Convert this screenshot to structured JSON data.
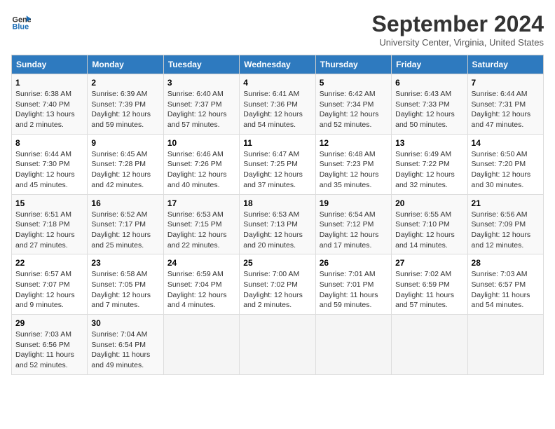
{
  "header": {
    "logo_line1": "General",
    "logo_line2": "Blue",
    "month": "September 2024",
    "location": "University Center, Virginia, United States"
  },
  "columns": [
    "Sunday",
    "Monday",
    "Tuesday",
    "Wednesday",
    "Thursday",
    "Friday",
    "Saturday"
  ],
  "weeks": [
    [
      {
        "day": "1",
        "info": "Sunrise: 6:38 AM\nSunset: 7:40 PM\nDaylight: 13 hours\nand 2 minutes."
      },
      {
        "day": "2",
        "info": "Sunrise: 6:39 AM\nSunset: 7:39 PM\nDaylight: 12 hours\nand 59 minutes."
      },
      {
        "day": "3",
        "info": "Sunrise: 6:40 AM\nSunset: 7:37 PM\nDaylight: 12 hours\nand 57 minutes."
      },
      {
        "day": "4",
        "info": "Sunrise: 6:41 AM\nSunset: 7:36 PM\nDaylight: 12 hours\nand 54 minutes."
      },
      {
        "day": "5",
        "info": "Sunrise: 6:42 AM\nSunset: 7:34 PM\nDaylight: 12 hours\nand 52 minutes."
      },
      {
        "day": "6",
        "info": "Sunrise: 6:43 AM\nSunset: 7:33 PM\nDaylight: 12 hours\nand 50 minutes."
      },
      {
        "day": "7",
        "info": "Sunrise: 6:44 AM\nSunset: 7:31 PM\nDaylight: 12 hours\nand 47 minutes."
      }
    ],
    [
      {
        "day": "8",
        "info": "Sunrise: 6:44 AM\nSunset: 7:30 PM\nDaylight: 12 hours\nand 45 minutes."
      },
      {
        "day": "9",
        "info": "Sunrise: 6:45 AM\nSunset: 7:28 PM\nDaylight: 12 hours\nand 42 minutes."
      },
      {
        "day": "10",
        "info": "Sunrise: 6:46 AM\nSunset: 7:26 PM\nDaylight: 12 hours\nand 40 minutes."
      },
      {
        "day": "11",
        "info": "Sunrise: 6:47 AM\nSunset: 7:25 PM\nDaylight: 12 hours\nand 37 minutes."
      },
      {
        "day": "12",
        "info": "Sunrise: 6:48 AM\nSunset: 7:23 PM\nDaylight: 12 hours\nand 35 minutes."
      },
      {
        "day": "13",
        "info": "Sunrise: 6:49 AM\nSunset: 7:22 PM\nDaylight: 12 hours\nand 32 minutes."
      },
      {
        "day": "14",
        "info": "Sunrise: 6:50 AM\nSunset: 7:20 PM\nDaylight: 12 hours\nand 30 minutes."
      }
    ],
    [
      {
        "day": "15",
        "info": "Sunrise: 6:51 AM\nSunset: 7:18 PM\nDaylight: 12 hours\nand 27 minutes."
      },
      {
        "day": "16",
        "info": "Sunrise: 6:52 AM\nSunset: 7:17 PM\nDaylight: 12 hours\nand 25 minutes."
      },
      {
        "day": "17",
        "info": "Sunrise: 6:53 AM\nSunset: 7:15 PM\nDaylight: 12 hours\nand 22 minutes."
      },
      {
        "day": "18",
        "info": "Sunrise: 6:53 AM\nSunset: 7:13 PM\nDaylight: 12 hours\nand 20 minutes."
      },
      {
        "day": "19",
        "info": "Sunrise: 6:54 AM\nSunset: 7:12 PM\nDaylight: 12 hours\nand 17 minutes."
      },
      {
        "day": "20",
        "info": "Sunrise: 6:55 AM\nSunset: 7:10 PM\nDaylight: 12 hours\nand 14 minutes."
      },
      {
        "day": "21",
        "info": "Sunrise: 6:56 AM\nSunset: 7:09 PM\nDaylight: 12 hours\nand 12 minutes."
      }
    ],
    [
      {
        "day": "22",
        "info": "Sunrise: 6:57 AM\nSunset: 7:07 PM\nDaylight: 12 hours\nand 9 minutes."
      },
      {
        "day": "23",
        "info": "Sunrise: 6:58 AM\nSunset: 7:05 PM\nDaylight: 12 hours\nand 7 minutes."
      },
      {
        "day": "24",
        "info": "Sunrise: 6:59 AM\nSunset: 7:04 PM\nDaylight: 12 hours\nand 4 minutes."
      },
      {
        "day": "25",
        "info": "Sunrise: 7:00 AM\nSunset: 7:02 PM\nDaylight: 12 hours\nand 2 minutes."
      },
      {
        "day": "26",
        "info": "Sunrise: 7:01 AM\nSunset: 7:01 PM\nDaylight: 11 hours\nand 59 minutes."
      },
      {
        "day": "27",
        "info": "Sunrise: 7:02 AM\nSunset: 6:59 PM\nDaylight: 11 hours\nand 57 minutes."
      },
      {
        "day": "28",
        "info": "Sunrise: 7:03 AM\nSunset: 6:57 PM\nDaylight: 11 hours\nand 54 minutes."
      }
    ],
    [
      {
        "day": "29",
        "info": "Sunrise: 7:03 AM\nSunset: 6:56 PM\nDaylight: 11 hours\nand 52 minutes."
      },
      {
        "day": "30",
        "info": "Sunrise: 7:04 AM\nSunset: 6:54 PM\nDaylight: 11 hours\nand 49 minutes."
      },
      {
        "day": "",
        "info": ""
      },
      {
        "day": "",
        "info": ""
      },
      {
        "day": "",
        "info": ""
      },
      {
        "day": "",
        "info": ""
      },
      {
        "day": "",
        "info": ""
      }
    ]
  ]
}
